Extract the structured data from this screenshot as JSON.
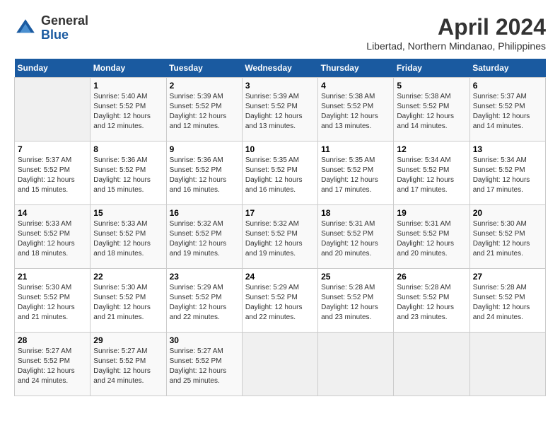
{
  "header": {
    "logo_general": "General",
    "logo_blue": "Blue",
    "month_title": "April 2024",
    "location": "Libertad, Northern Mindanao, Philippines"
  },
  "columns": [
    "Sunday",
    "Monday",
    "Tuesday",
    "Wednesday",
    "Thursday",
    "Friday",
    "Saturday"
  ],
  "weeks": [
    [
      {
        "day": "",
        "empty": true
      },
      {
        "day": "1",
        "sunrise": "5:40 AM",
        "sunset": "5:52 PM",
        "daylight": "12 hours and 12 minutes."
      },
      {
        "day": "2",
        "sunrise": "5:39 AM",
        "sunset": "5:52 PM",
        "daylight": "12 hours and 12 minutes."
      },
      {
        "day": "3",
        "sunrise": "5:39 AM",
        "sunset": "5:52 PM",
        "daylight": "12 hours and 13 minutes."
      },
      {
        "day": "4",
        "sunrise": "5:38 AM",
        "sunset": "5:52 PM",
        "daylight": "12 hours and 13 minutes."
      },
      {
        "day": "5",
        "sunrise": "5:38 AM",
        "sunset": "5:52 PM",
        "daylight": "12 hours and 14 minutes."
      },
      {
        "day": "6",
        "sunrise": "5:37 AM",
        "sunset": "5:52 PM",
        "daylight": "12 hours and 14 minutes."
      }
    ],
    [
      {
        "day": "7",
        "sunrise": "5:37 AM",
        "sunset": "5:52 PM",
        "daylight": "12 hours and 15 minutes."
      },
      {
        "day": "8",
        "sunrise": "5:36 AM",
        "sunset": "5:52 PM",
        "daylight": "12 hours and 15 minutes."
      },
      {
        "day": "9",
        "sunrise": "5:36 AM",
        "sunset": "5:52 PM",
        "daylight": "12 hours and 16 minutes."
      },
      {
        "day": "10",
        "sunrise": "5:35 AM",
        "sunset": "5:52 PM",
        "daylight": "12 hours and 16 minutes."
      },
      {
        "day": "11",
        "sunrise": "5:35 AM",
        "sunset": "5:52 PM",
        "daylight": "12 hours and 17 minutes."
      },
      {
        "day": "12",
        "sunrise": "5:34 AM",
        "sunset": "5:52 PM",
        "daylight": "12 hours and 17 minutes."
      },
      {
        "day": "13",
        "sunrise": "5:34 AM",
        "sunset": "5:52 PM",
        "daylight": "12 hours and 17 minutes."
      }
    ],
    [
      {
        "day": "14",
        "sunrise": "5:33 AM",
        "sunset": "5:52 PM",
        "daylight": "12 hours and 18 minutes."
      },
      {
        "day": "15",
        "sunrise": "5:33 AM",
        "sunset": "5:52 PM",
        "daylight": "12 hours and 18 minutes."
      },
      {
        "day": "16",
        "sunrise": "5:32 AM",
        "sunset": "5:52 PM",
        "daylight": "12 hours and 19 minutes."
      },
      {
        "day": "17",
        "sunrise": "5:32 AM",
        "sunset": "5:52 PM",
        "daylight": "12 hours and 19 minutes."
      },
      {
        "day": "18",
        "sunrise": "5:31 AM",
        "sunset": "5:52 PM",
        "daylight": "12 hours and 20 minutes."
      },
      {
        "day": "19",
        "sunrise": "5:31 AM",
        "sunset": "5:52 PM",
        "daylight": "12 hours and 20 minutes."
      },
      {
        "day": "20",
        "sunrise": "5:30 AM",
        "sunset": "5:52 PM",
        "daylight": "12 hours and 21 minutes."
      }
    ],
    [
      {
        "day": "21",
        "sunrise": "5:30 AM",
        "sunset": "5:52 PM",
        "daylight": "12 hours and 21 minutes."
      },
      {
        "day": "22",
        "sunrise": "5:30 AM",
        "sunset": "5:52 PM",
        "daylight": "12 hours and 21 minutes."
      },
      {
        "day": "23",
        "sunrise": "5:29 AM",
        "sunset": "5:52 PM",
        "daylight": "12 hours and 22 minutes."
      },
      {
        "day": "24",
        "sunrise": "5:29 AM",
        "sunset": "5:52 PM",
        "daylight": "12 hours and 22 minutes."
      },
      {
        "day": "25",
        "sunrise": "5:28 AM",
        "sunset": "5:52 PM",
        "daylight": "12 hours and 23 minutes."
      },
      {
        "day": "26",
        "sunrise": "5:28 AM",
        "sunset": "5:52 PM",
        "daylight": "12 hours and 23 minutes."
      },
      {
        "day": "27",
        "sunrise": "5:28 AM",
        "sunset": "5:52 PM",
        "daylight": "12 hours and 24 minutes."
      }
    ],
    [
      {
        "day": "28",
        "sunrise": "5:27 AM",
        "sunset": "5:52 PM",
        "daylight": "12 hours and 24 minutes."
      },
      {
        "day": "29",
        "sunrise": "5:27 AM",
        "sunset": "5:52 PM",
        "daylight": "12 hours and 24 minutes."
      },
      {
        "day": "30",
        "sunrise": "5:27 AM",
        "sunset": "5:52 PM",
        "daylight": "12 hours and 25 minutes."
      },
      {
        "day": "",
        "empty": true
      },
      {
        "day": "",
        "empty": true
      },
      {
        "day": "",
        "empty": true
      },
      {
        "day": "",
        "empty": true
      }
    ]
  ]
}
